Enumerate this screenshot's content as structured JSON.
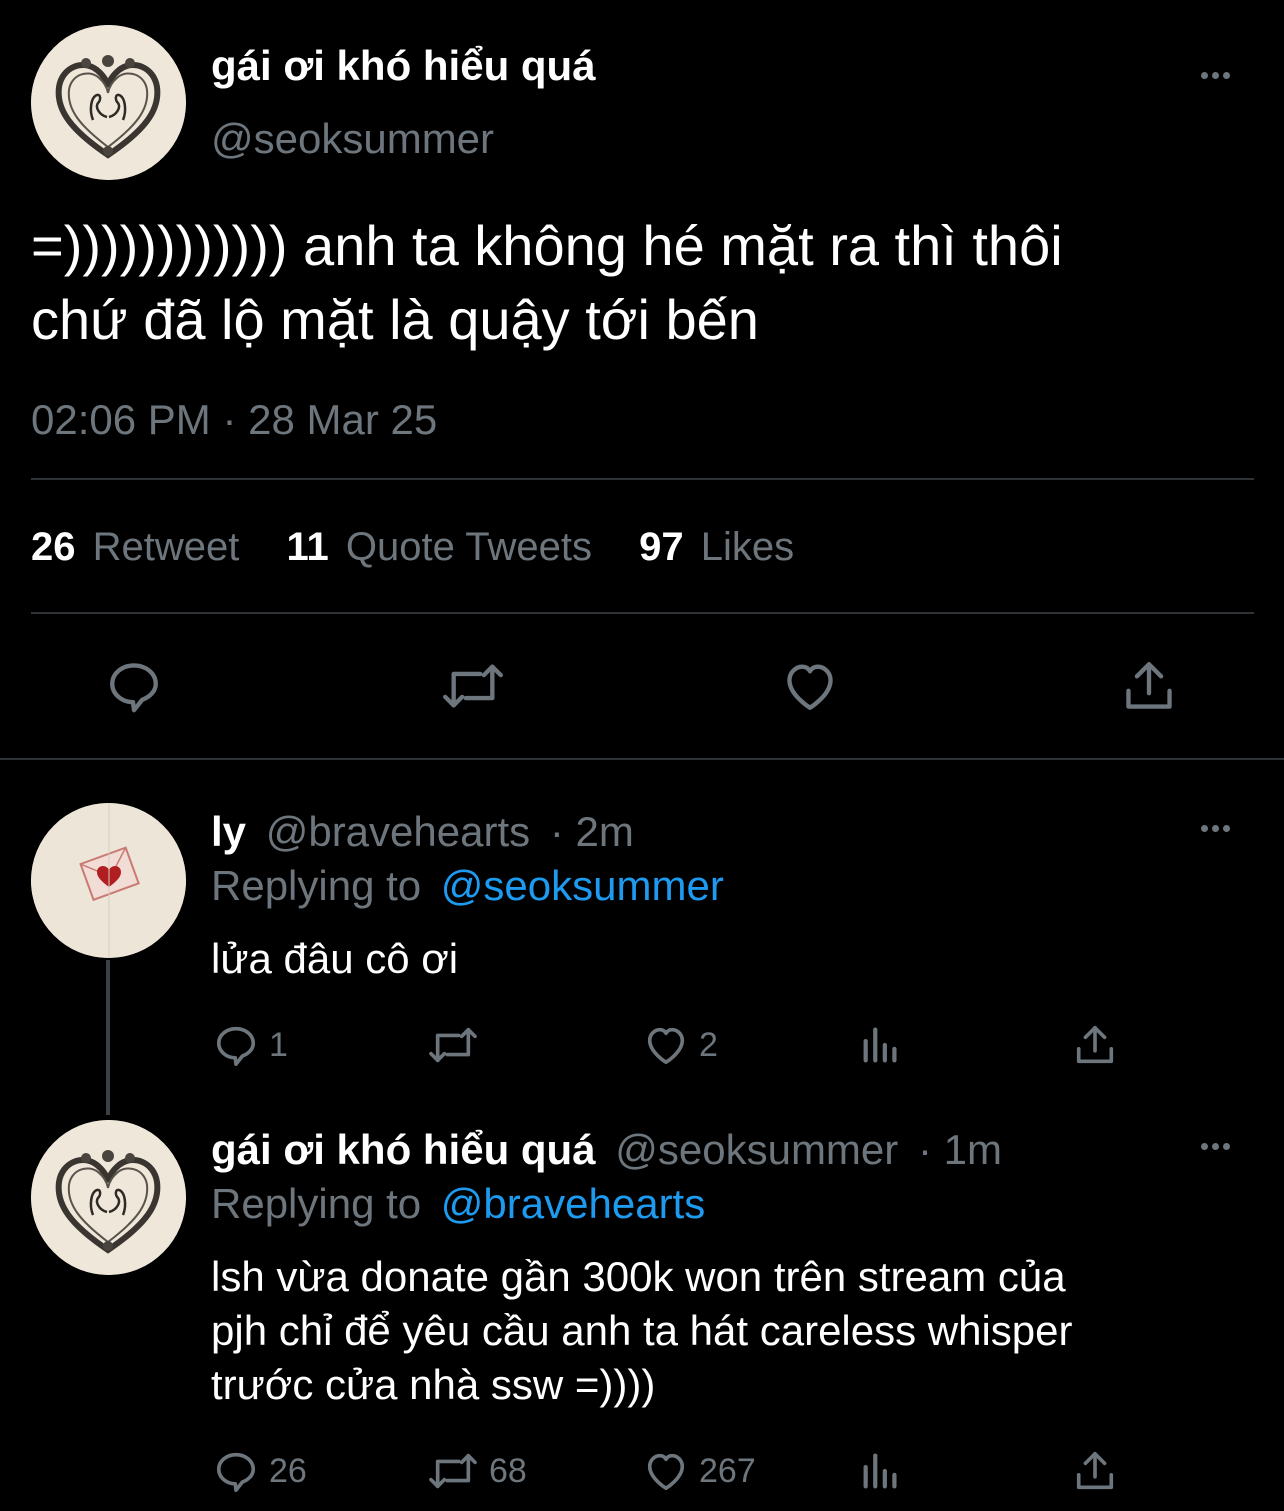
{
  "main_tweet": {
    "display_name": "gái ơi khó hiểu quá",
    "handle": "@seoksummer",
    "text_line1": "=)))))))))))) anh ta không hé mặt ra thì thôi",
    "text_line2": "chứ đã lộ mặt là quậy tới bến",
    "timestamp": "02:06 PM · 28 Mar 25",
    "stats": {
      "retweets_count": "26",
      "retweets_label": "Retweet",
      "quotes_count": "11",
      "quotes_label": "Quote Tweets",
      "likes_count": "97",
      "likes_label": "Likes"
    }
  },
  "replies": [
    {
      "display_name": "ly",
      "handle": "@bravehearts",
      "time": "· 2m",
      "replying_prefix": "Replying to",
      "replying_to": "@seoksummer",
      "text_lines": [
        "lửa đâu cô ơi"
      ],
      "reply_count": "1",
      "retweet_count": "",
      "like_count": "2"
    },
    {
      "display_name": "gái ơi khó hiểu quá",
      "handle": "@seoksummer",
      "time": "· 1m",
      "replying_prefix": "Replying to",
      "replying_to": "@bravehearts",
      "text_lines": [
        "lsh vừa donate gần 300k won trên stream của",
        "pjh chỉ để yêu cầu anh ta hát careless whisper",
        "trước cửa nhà ssw =))))"
      ],
      "reply_count": "26",
      "retweet_count": "68",
      "like_count": "267"
    }
  ],
  "icons": [
    "reply-icon",
    "retweet-icon",
    "like-icon",
    "share-icon",
    "analytics-icon",
    "more-icon"
  ],
  "colors": {
    "background": "#000000",
    "text": "#ffffff",
    "muted": "#6e767d",
    "link": "#1d9bf0",
    "divider": "#2f3336"
  }
}
